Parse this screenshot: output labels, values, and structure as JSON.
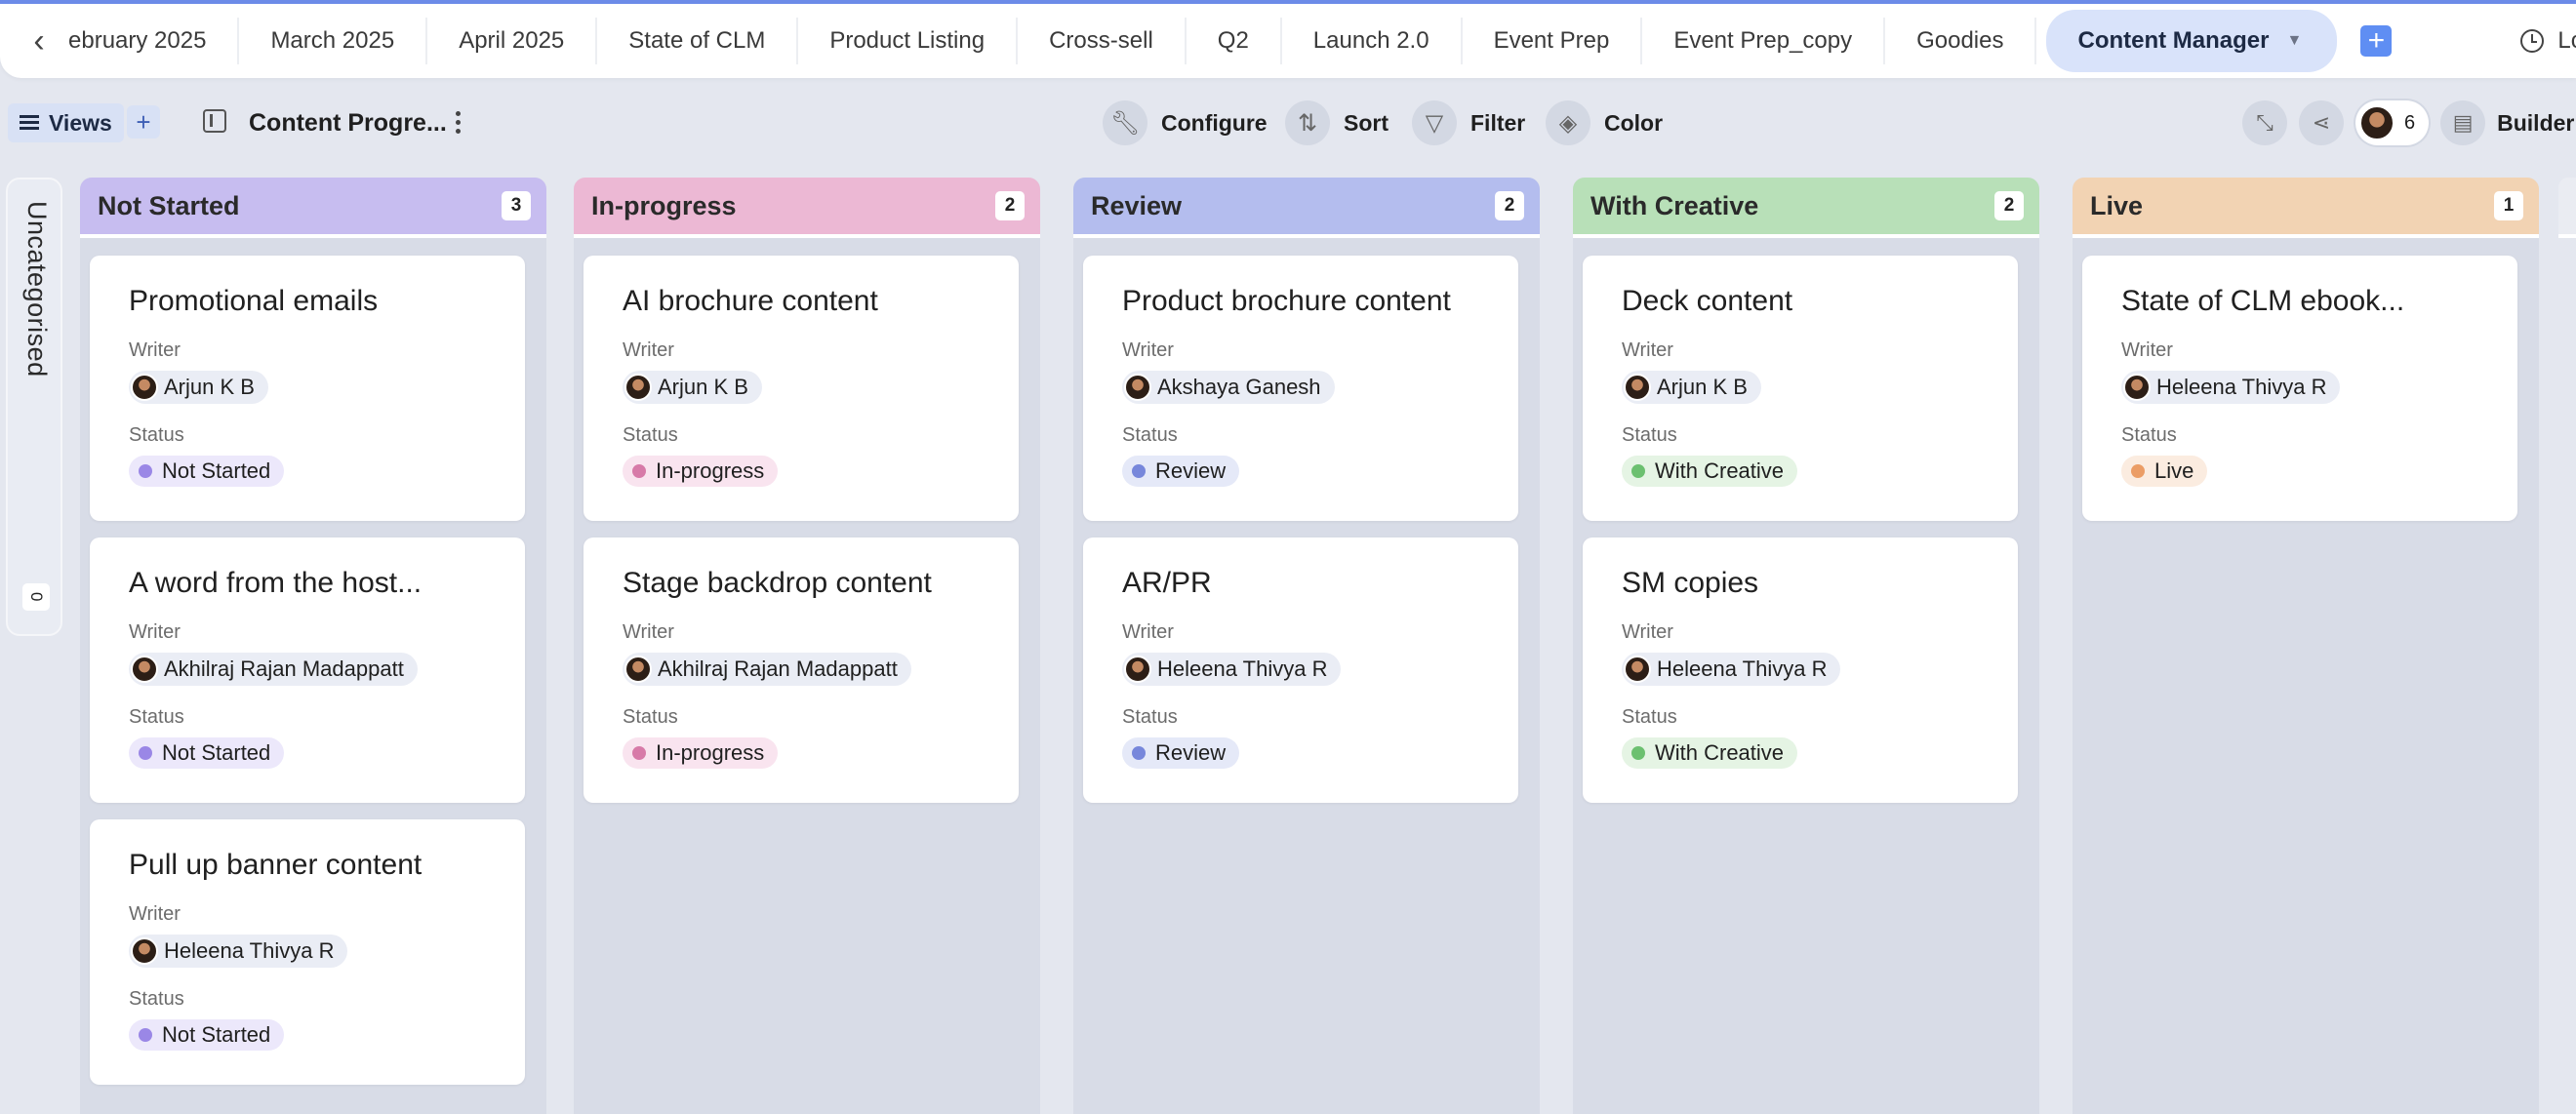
{
  "tabbar": {
    "tabs": [
      "ebruary 2025",
      "March 2025",
      "April 2025",
      "State of CLM",
      "Product Listing",
      "Cross-sell",
      "Q2",
      "Launch 2.0",
      "Event Prep",
      "Event Prep_copy",
      "Goodies"
    ],
    "active_tab": "Content Manager",
    "log_label": "Log"
  },
  "toolbar": {
    "views_label": "Views",
    "view_title": "Content Progre...",
    "configure": "Configure",
    "sort": "Sort",
    "filter": "Filter",
    "color": "Color",
    "collaborators_count": "6",
    "builder": "Builder"
  },
  "uncategorised": {
    "label": "Uncategorised",
    "count": "0"
  },
  "labels": {
    "writer": "Writer",
    "status": "Status"
  },
  "columns": [
    {
      "title": "Not Started",
      "count": "3",
      "color": "#c7bdf0",
      "dot": "#9a87e6",
      "chip": "#ece8fb",
      "cards": [
        {
          "title": "Promotional emails",
          "writer": "Arjun K B",
          "status": "Not Started"
        },
        {
          "title": "A word from the host...",
          "writer": "Akhilraj Rajan Madappatt",
          "status": "Not Started"
        },
        {
          "title": "Pull up banner content",
          "writer": "Heleena Thivya R",
          "status": "Not Started"
        }
      ]
    },
    {
      "title": "In-progress",
      "count": "2",
      "color": "#ecb8d4",
      "dot": "#d77aa8",
      "chip": "#f9e4ef",
      "cards": [
        {
          "title": "AI brochure content",
          "writer": "Arjun K B",
          "status": "In-progress"
        },
        {
          "title": "Stage backdrop content",
          "writer": "Akhilraj Rajan Madappatt",
          "status": "In-progress"
        }
      ]
    },
    {
      "title": "Review",
      "count": "2",
      "color": "#b4bdee",
      "dot": "#7787db",
      "chip": "#e5e9f8",
      "cards": [
        {
          "title": "Product brochure content",
          "writer": "Akshaya Ganesh",
          "status": "Review"
        },
        {
          "title": "AR/PR",
          "writer": "Heleena Thivya R",
          "status": "Review"
        }
      ]
    },
    {
      "title": "With Creative",
      "count": "2",
      "color": "#b8e0b8",
      "dot": "#6cc070",
      "chip": "#e5f4e4",
      "cards": [
        {
          "title": "Deck content",
          "writer": "Arjun K B",
          "status": "With Creative"
        },
        {
          "title": "SM copies",
          "writer": "Heleena Thivya R",
          "status": "With Creative"
        }
      ]
    },
    {
      "title": "Live",
      "count": "1",
      "color": "#f2d3b3",
      "dot": "#eb9d66",
      "chip": "#fbece0",
      "cards": [
        {
          "title": "State of CLM ebook...",
          "writer": "Heleena Thivya R",
          "status": "Live"
        }
      ]
    }
  ]
}
